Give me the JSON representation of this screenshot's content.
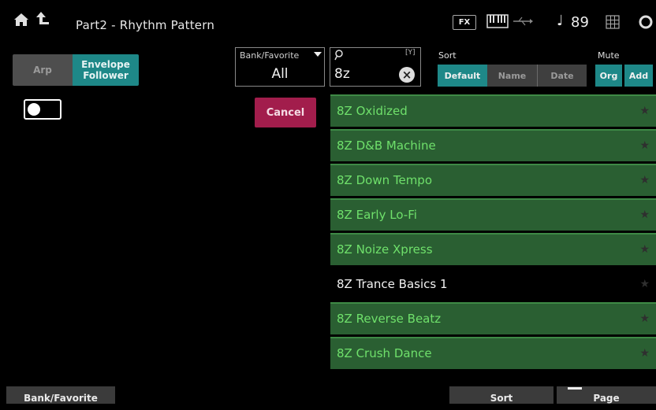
{
  "header": {
    "title": "Part2 - Rhythm Pattern",
    "fx_label": "FX",
    "tempo": "89",
    "icons": [
      "home-icon",
      "up-arrow-icon",
      "keyboard-icon",
      "usb-icon",
      "note-icon",
      "grid-icon",
      "gear-icon"
    ]
  },
  "tabs": {
    "arp": "Arp",
    "envelope_follower": "Envelope Follower"
  },
  "bank": {
    "label": "Bank/Favorite",
    "value": "All"
  },
  "search": {
    "hint": "[Y]",
    "value": "8z"
  },
  "sort": {
    "label": "Sort",
    "options": [
      "Default",
      "Name",
      "Date"
    ],
    "selected": "Default"
  },
  "mute": {
    "label": "Mute",
    "org": "Org",
    "add": "Add"
  },
  "cancel_label": "Cancel",
  "list": {
    "items": [
      {
        "label": "8Z Oxidized"
      },
      {
        "label": "8Z D&B Machine"
      },
      {
        "label": "8Z Down Tempo"
      },
      {
        "label": "8Z Early Lo-Fi"
      },
      {
        "label": "8Z Noize Xpress"
      },
      {
        "label": "8Z Trance Basics 1"
      },
      {
        "label": "8Z Reverse Beatz"
      },
      {
        "label": "8Z Crush Dance"
      }
    ],
    "selected_index": 5
  },
  "bottom": {
    "bank_favorite": "Bank/Favorite",
    "sort": "Sort",
    "page": "Page"
  },
  "colors": {
    "accent_teal": "#1e8888",
    "list_green": "#2a5f32",
    "list_text": "#6fe06b",
    "cancel": "#a21d4c"
  }
}
